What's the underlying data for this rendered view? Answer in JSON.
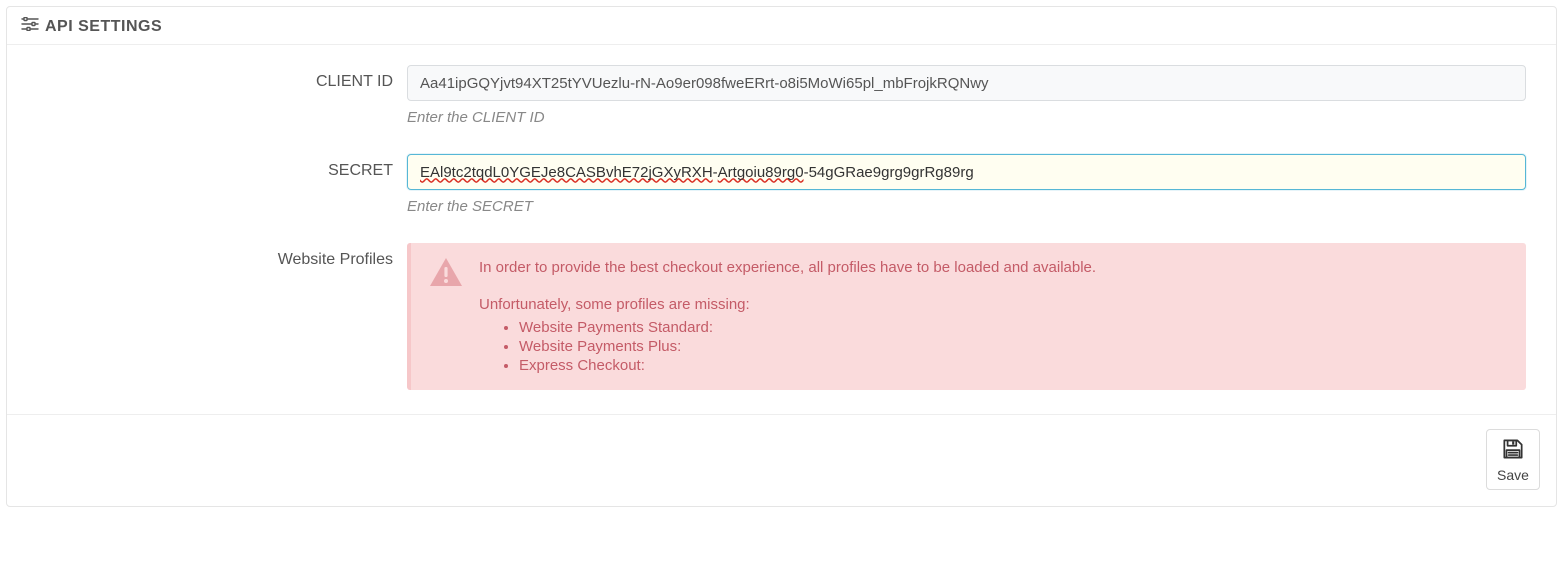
{
  "panel": {
    "title": "API SETTINGS"
  },
  "clientId": {
    "label": "CLIENT ID",
    "value": "Aa41ipGQYjvt94XT25tYVUezlu-rN-Ao9er098fweERrt-o8i5MoWi65pl_mbFrojkRQNwy",
    "help": "Enter the CLIENT ID"
  },
  "secret": {
    "label": "SECRET",
    "value_part1": "EAl9tc2tqdL0YGEJe8CASBvhE72jGXyRXH",
    "value_sep1": "-",
    "value_part2": "Artgoiu89rg0",
    "value_sep2": "-",
    "value_part3": "54gGRae9grg9grRg89rg",
    "help": "Enter the SECRET"
  },
  "profiles": {
    "label": "Website Profiles",
    "line1": "In order to provide the best checkout experience, all profiles have to be loaded and available.",
    "line2": "Unfortunately, some profiles are missing:",
    "items": [
      "Website Payments Standard:",
      "Website Payments Plus:",
      "Express Checkout:"
    ]
  },
  "footer": {
    "save": "Save"
  }
}
